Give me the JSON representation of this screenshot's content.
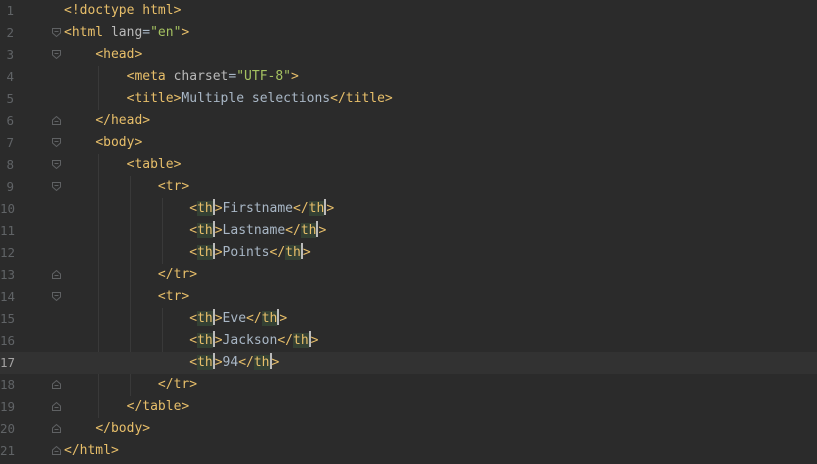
{
  "editor": {
    "language": "html",
    "current_line": 17,
    "lines": [
      {
        "n": "1",
        "segs": [
          [
            "tag",
            "<!doctype html>"
          ]
        ]
      },
      {
        "n": "2",
        "segs": [
          [
            "tag",
            "<html "
          ],
          [
            "attr",
            "lang"
          ],
          [
            "txt",
            "="
          ],
          [
            "val",
            "\"en\""
          ],
          [
            "tag",
            ">"
          ]
        ]
      },
      {
        "n": "3",
        "segs": [
          [
            "sp",
            "    "
          ],
          [
            "tag",
            "<head>"
          ]
        ]
      },
      {
        "n": "4",
        "segs": [
          [
            "sp",
            "        "
          ],
          [
            "tag",
            "<meta "
          ],
          [
            "attr",
            "charset"
          ],
          [
            "txt",
            "="
          ],
          [
            "val",
            "\"UTF-8\""
          ],
          [
            "tag",
            ">"
          ]
        ]
      },
      {
        "n": "5",
        "segs": [
          [
            "sp",
            "        "
          ],
          [
            "tag",
            "<title>"
          ],
          [
            "txt",
            "Multiple selections"
          ],
          [
            "tag",
            "</title>"
          ]
        ]
      },
      {
        "n": "6",
        "segs": [
          [
            "sp",
            "    "
          ],
          [
            "tag",
            "</head>"
          ]
        ]
      },
      {
        "n": "7",
        "segs": [
          [
            "sp",
            "    "
          ],
          [
            "tag",
            "<body>"
          ]
        ]
      },
      {
        "n": "8",
        "segs": [
          [
            "sp",
            "        "
          ],
          [
            "tag",
            "<table>"
          ]
        ]
      },
      {
        "n": "9",
        "segs": [
          [
            "sp",
            "            "
          ],
          [
            "tag",
            "<tr>"
          ]
        ]
      },
      {
        "n": "10",
        "segs": [
          [
            "sp",
            "                "
          ],
          [
            "tag",
            "<"
          ],
          [
            "hl",
            "th"
          ],
          [
            "caret",
            ""
          ],
          [
            "tag",
            ">"
          ],
          [
            "txt",
            "Firstname"
          ],
          [
            "tag",
            "</"
          ],
          [
            "hl",
            "th"
          ],
          [
            "caret",
            ""
          ],
          [
            "tag",
            ">"
          ]
        ]
      },
      {
        "n": "11",
        "segs": [
          [
            "sp",
            "                "
          ],
          [
            "tag",
            "<"
          ],
          [
            "hl",
            "th"
          ],
          [
            "caret",
            ""
          ],
          [
            "tag",
            ">"
          ],
          [
            "txt",
            "Lastname"
          ],
          [
            "tag",
            "</"
          ],
          [
            "hl",
            "th"
          ],
          [
            "caret",
            ""
          ],
          [
            "tag",
            ">"
          ]
        ]
      },
      {
        "n": "12",
        "segs": [
          [
            "sp",
            "                "
          ],
          [
            "tag",
            "<"
          ],
          [
            "hl",
            "th"
          ],
          [
            "caret",
            ""
          ],
          [
            "tag",
            ">"
          ],
          [
            "txt",
            "Points"
          ],
          [
            "tag",
            "</"
          ],
          [
            "hl",
            "th"
          ],
          [
            "caret",
            ""
          ],
          [
            "tag",
            ">"
          ]
        ]
      },
      {
        "n": "13",
        "segs": [
          [
            "sp",
            "            "
          ],
          [
            "tag",
            "</tr>"
          ]
        ]
      },
      {
        "n": "14",
        "segs": [
          [
            "sp",
            "            "
          ],
          [
            "tag",
            "<tr>"
          ]
        ]
      },
      {
        "n": "15",
        "segs": [
          [
            "sp",
            "                "
          ],
          [
            "tag",
            "<"
          ],
          [
            "hl",
            "th"
          ],
          [
            "caret",
            ""
          ],
          [
            "tag",
            ">"
          ],
          [
            "txt",
            "Eve"
          ],
          [
            "tag",
            "</"
          ],
          [
            "hl",
            "th"
          ],
          [
            "caret",
            ""
          ],
          [
            "tag",
            ">"
          ]
        ]
      },
      {
        "n": "16",
        "segs": [
          [
            "sp",
            "                "
          ],
          [
            "tag",
            "<"
          ],
          [
            "hl",
            "th"
          ],
          [
            "caret",
            ""
          ],
          [
            "tag",
            ">"
          ],
          [
            "txt",
            "Jackson"
          ],
          [
            "tag",
            "</"
          ],
          [
            "hl",
            "th"
          ],
          [
            "caret",
            ""
          ],
          [
            "tag",
            ">"
          ]
        ]
      },
      {
        "n": "17",
        "segs": [
          [
            "sp",
            "                "
          ],
          [
            "tag",
            "<"
          ],
          [
            "hl",
            "th"
          ],
          [
            "caret",
            ""
          ],
          [
            "tag",
            ">"
          ],
          [
            "txt",
            "94"
          ],
          [
            "tag",
            "</"
          ],
          [
            "hl",
            "th"
          ],
          [
            "caret",
            ""
          ],
          [
            "tag",
            ">"
          ]
        ]
      },
      {
        "n": "18",
        "segs": [
          [
            "sp",
            "            "
          ],
          [
            "tag",
            "</tr>"
          ]
        ]
      },
      {
        "n": "19",
        "segs": [
          [
            "sp",
            "        "
          ],
          [
            "tag",
            "</table>"
          ]
        ]
      },
      {
        "n": "20",
        "segs": [
          [
            "sp",
            "    "
          ],
          [
            "tag",
            "</body>"
          ]
        ]
      },
      {
        "n": "21",
        "segs": [
          [
            "tag",
            "</html>"
          ]
        ]
      }
    ],
    "fold_markers": [
      {
        "line": "2",
        "kind": "open"
      },
      {
        "line": "3",
        "kind": "open"
      },
      {
        "line": "6",
        "kind": "close"
      },
      {
        "line": "7",
        "kind": "open"
      },
      {
        "line": "8",
        "kind": "open"
      },
      {
        "line": "9",
        "kind": "open"
      },
      {
        "line": "13",
        "kind": "close"
      },
      {
        "line": "14",
        "kind": "open"
      },
      {
        "line": "18",
        "kind": "close"
      },
      {
        "line": "19",
        "kind": "close"
      },
      {
        "line": "20",
        "kind": "close"
      },
      {
        "line": "21",
        "kind": "close"
      }
    ],
    "fold_icon": "fold-marker-icon",
    "colors": {
      "background": "#2b2b2b",
      "current_line": "#323232",
      "tag": "#e8bf6a",
      "attribute": "#bababa",
      "value": "#a5c261",
      "text": "#a9b7c6",
      "line_number": "#606366",
      "match_highlight": "#344134",
      "caret": "#bbbbbb"
    }
  }
}
